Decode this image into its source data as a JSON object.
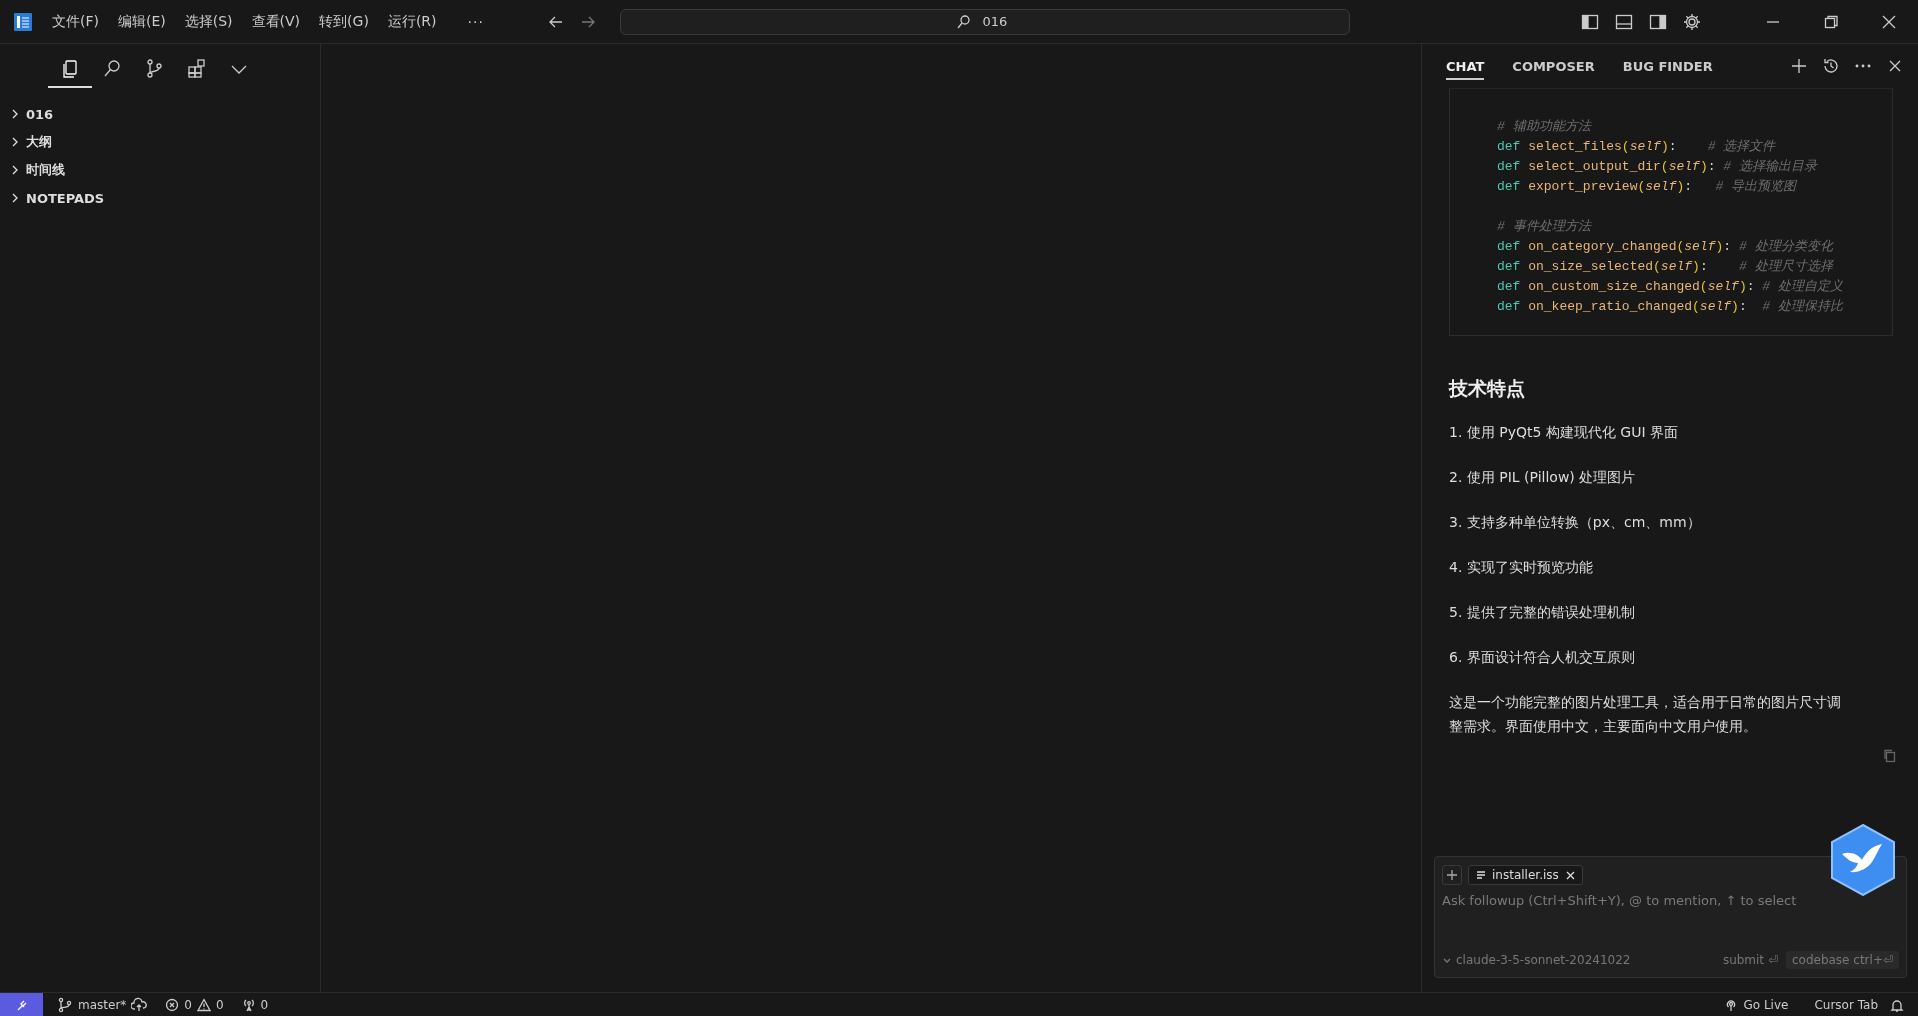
{
  "title_bar": {
    "menus": [
      "文件(F)",
      "编辑(E)",
      "选择(S)",
      "查看(V)",
      "转到(G)",
      "运行(R)"
    ],
    "more": "···",
    "search": {
      "value": "016"
    }
  },
  "sidebar": {
    "views": [
      {
        "kind": "files",
        "selected": true
      },
      {
        "kind": "search",
        "selected": false
      },
      {
        "kind": "source-control",
        "selected": false
      },
      {
        "kind": "extensions",
        "selected": false
      },
      {
        "kind": "more",
        "selected": false
      }
    ],
    "sections": [
      {
        "label": "016",
        "expanded": false
      },
      {
        "label": "大纲",
        "expanded": false
      },
      {
        "label": "时间线",
        "expanded": false
      },
      {
        "label": "NOTEPADS",
        "expanded": false
      }
    ]
  },
  "chat": {
    "tabs": [
      {
        "label": "CHAT",
        "selected": true
      },
      {
        "label": "COMPOSER",
        "selected": false
      },
      {
        "label": "BUG FINDER",
        "selected": false
      }
    ],
    "code_lines": [
      {
        "kind": "blank"
      },
      {
        "kind": "code",
        "tokens": [
          {
            "kind": "comment",
            "text": "# 辅助功能方法"
          }
        ]
      },
      {
        "kind": "code",
        "tokens": [
          {
            "kind": "keyword",
            "text": "def "
          },
          {
            "kind": "function",
            "text": "select_files"
          },
          {
            "kind": "paren",
            "text": "("
          },
          {
            "kind": "param",
            "text": "self"
          },
          {
            "kind": "paren",
            "text": ")"
          },
          {
            "kind": "punct",
            "text": ":    "
          },
          {
            "kind": "comment",
            "text": "# 选择文件"
          }
        ]
      },
      {
        "kind": "code",
        "tokens": [
          {
            "kind": "keyword",
            "text": "def "
          },
          {
            "kind": "function",
            "text": "select_output_dir"
          },
          {
            "kind": "paren",
            "text": "("
          },
          {
            "kind": "param",
            "text": "self"
          },
          {
            "kind": "paren",
            "text": ")"
          },
          {
            "kind": "punct",
            "text": ": "
          },
          {
            "kind": "comment",
            "text": "# 选择输出目录"
          }
        ]
      },
      {
        "kind": "code",
        "tokens": [
          {
            "kind": "keyword",
            "text": "def "
          },
          {
            "kind": "function",
            "text": "export_preview"
          },
          {
            "kind": "paren",
            "text": "("
          },
          {
            "kind": "param",
            "text": "self"
          },
          {
            "kind": "paren",
            "text": ")"
          },
          {
            "kind": "punct",
            "text": ":   "
          },
          {
            "kind": "comment",
            "text": "# 导出预览图"
          }
        ]
      },
      {
        "kind": "blank"
      },
      {
        "kind": "code",
        "tokens": [
          {
            "kind": "comment",
            "text": "# 事件处理方法"
          }
        ]
      },
      {
        "kind": "code",
        "tokens": [
          {
            "kind": "keyword",
            "text": "def "
          },
          {
            "kind": "function",
            "text": "on_category_changed"
          },
          {
            "kind": "paren",
            "text": "("
          },
          {
            "kind": "param",
            "text": "self"
          },
          {
            "kind": "paren",
            "text": ")"
          },
          {
            "kind": "punct",
            "text": ": "
          },
          {
            "kind": "comment",
            "text": "# 处理分类变化"
          }
        ]
      },
      {
        "kind": "code",
        "tokens": [
          {
            "kind": "keyword",
            "text": "def "
          },
          {
            "kind": "function",
            "text": "on_size_selected"
          },
          {
            "kind": "paren",
            "text": "("
          },
          {
            "kind": "param",
            "text": "self"
          },
          {
            "kind": "paren",
            "text": ")"
          },
          {
            "kind": "punct",
            "text": ":    "
          },
          {
            "kind": "comment",
            "text": "# 处理尺寸选择"
          }
        ]
      },
      {
        "kind": "code",
        "tokens": [
          {
            "kind": "keyword",
            "text": "def "
          },
          {
            "kind": "function",
            "text": "on_custom_size_changed"
          },
          {
            "kind": "paren",
            "text": "("
          },
          {
            "kind": "param",
            "text": "self"
          },
          {
            "kind": "paren",
            "text": ")"
          },
          {
            "kind": "punct",
            "text": ": "
          },
          {
            "kind": "comment",
            "text": "# 处理自定义"
          }
        ]
      },
      {
        "kind": "code",
        "tokens": [
          {
            "kind": "keyword",
            "text": "def "
          },
          {
            "kind": "function",
            "text": "on_keep_ratio_changed"
          },
          {
            "kind": "paren",
            "text": "("
          },
          {
            "kind": "param",
            "text": "self"
          },
          {
            "kind": "paren",
            "text": ")"
          },
          {
            "kind": "punct",
            "text": ":  "
          },
          {
            "kind": "comment",
            "text": "# 处理保持比"
          }
        ]
      }
    ],
    "heading": "技术特点",
    "list": [
      "1. 使用 PyQt5 构建现代化 GUI 界面",
      "2. 使用 PIL (Pillow) 处理图片",
      "3. 支持多种单位转换（px、cm、mm）",
      "4. 实现了实时预览功能",
      "5. 提供了完整的错误处理机制",
      "6. 界面设计符合人机交互原则"
    ],
    "summary": "这是一个功能完整的图片处理工具，适合用于日常的图片尺寸调整需求。界面使用中文，主要面向中文用户使用。",
    "input": {
      "chips": [
        {
          "label": "installer.iss"
        }
      ],
      "placeholder": "Ask followup (Ctrl+Shift+Y), @ to mention, ↑ to select",
      "model": "claude-3-5-sonnet-20241022",
      "submit": "submit ⏎",
      "codebase": "codebase ctrl+⏎"
    }
  },
  "status_bar": {
    "branch": "master*",
    "errors": "0",
    "warnings": "0",
    "ports": "0",
    "go_live": "Go Live",
    "cursor_tab": "Cursor Tab"
  }
}
